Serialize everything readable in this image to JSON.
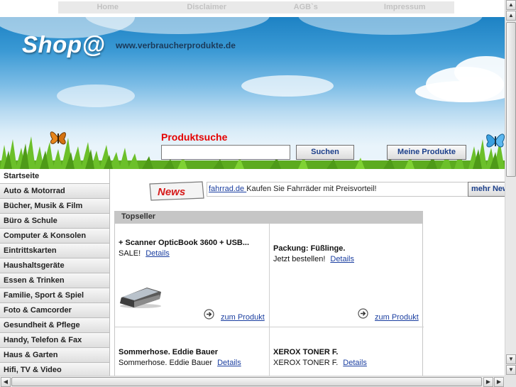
{
  "topnav": {
    "items": [
      {
        "label": "Home"
      },
      {
        "label": "Disclaimer"
      },
      {
        "label": "AGB`s"
      },
      {
        "label": "Impressum"
      }
    ]
  },
  "header": {
    "logo": "Shop@",
    "site_url": "www.verbraucherprodukte.de",
    "search_title": "Produktsuche",
    "search_value": "",
    "search_button": "Suchen",
    "my_products_button": "Meine Produkte"
  },
  "sidebar": {
    "items": [
      {
        "label": "Startseite"
      },
      {
        "label": "Auto & Motorrad"
      },
      {
        "label": "Bücher, Musik & Film"
      },
      {
        "label": "Büro & Schule"
      },
      {
        "label": "Computer & Konsolen"
      },
      {
        "label": "Eintrittskarten"
      },
      {
        "label": "Haushaltsgeräte"
      },
      {
        "label": "Essen & Trinken"
      },
      {
        "label": "Familie, Sport & Spiel"
      },
      {
        "label": "Foto & Camcorder"
      },
      {
        "label": "Gesundheit & Pflege"
      },
      {
        "label": "Handy, Telefon & Fax"
      },
      {
        "label": "Haus & Garten"
      },
      {
        "label": "Hifi, TV & Video"
      }
    ]
  },
  "news": {
    "badge": "News",
    "link_text": "fahrrad.de ",
    "text": "Kaufen Sie Fahrräder mit Preisvorteil!",
    "more_button": "mehr News"
  },
  "topseller": {
    "title": "Topseller",
    "products": [
      {
        "title": "+ Scanner OpticBook 3600 + USB...",
        "subtitle": "SALE!",
        "details_link": "Details",
        "cta": "zum Produkt",
        "image": "scanner-image"
      },
      {
        "title": "Packung: Füßlinge.",
        "subtitle": "Jetzt bestellen!",
        "details_link": "Details",
        "cta": "zum Produkt"
      },
      {
        "title": "Sommerhose. Eddie Bauer",
        "subtitle": "Sommerhose. Eddie Bauer",
        "details_link": "Details"
      },
      {
        "title": "XEROX TONER F.",
        "subtitle": "XEROX TONER F.",
        "details_link": "Details"
      }
    ]
  },
  "colors": {
    "brand_red": "#e50000",
    "link_blue": "#1a3ea0",
    "button_text": "#1b3f8a",
    "sky_blue": "#1d82c4"
  },
  "icons": {
    "arrow": "circle-arrow-right-icon",
    "butterfly_left": "orange-butterfly-icon",
    "butterfly_right": "blue-butterfly-icon"
  }
}
